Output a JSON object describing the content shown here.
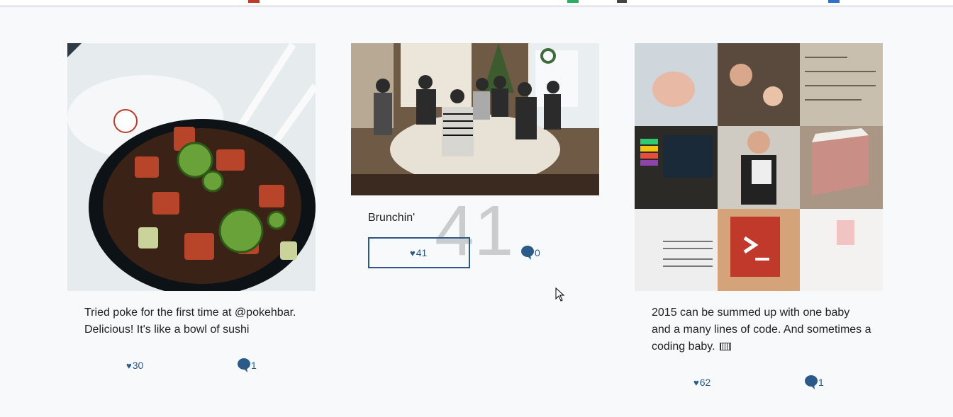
{
  "posts": [
    {
      "caption": "Tried poke for the first time at @pokehbar. Delicious! It's like a bowl of sushi",
      "likes": "30",
      "comments": "1",
      "image": "poke-bowl-photo"
    },
    {
      "caption": "Brunchin'",
      "likes": "41",
      "comments": "0",
      "image": "brunch-table-photo",
      "overlay_count": "41"
    },
    {
      "caption": "2015 can be summed up with one baby and a many lines of code. And sometimes a coding baby.",
      "likes": "62",
      "comments": "1",
      "image": "photo-collage-3x3"
    }
  ],
  "icons": {
    "like": "heart-icon",
    "comment": "speech-bubble-icon",
    "emoji": "keyboard-emoji-icon",
    "pointer": "mouse-cursor-icon"
  },
  "colors": {
    "accent": "#2a5a8a",
    "background": "#f8f9fa",
    "text": "#1f1f1f"
  }
}
